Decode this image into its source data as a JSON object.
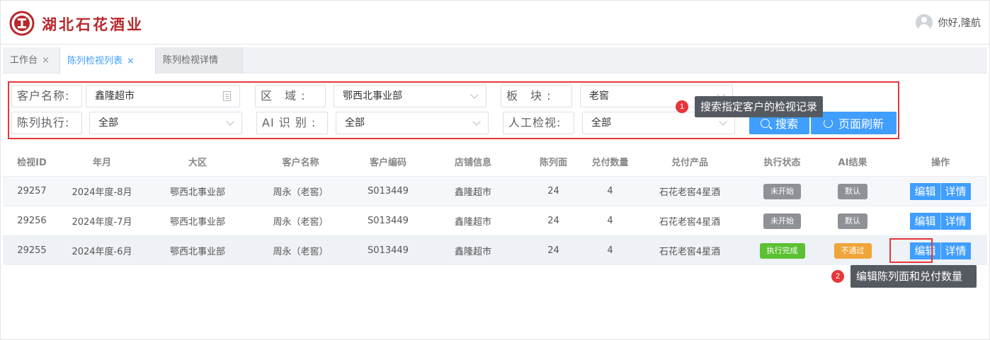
{
  "header": {
    "brand": "湖北石花酒业",
    "greeting": "你好,隆航",
    "colors": {
      "brand": "#b8282c",
      "accent": "#409eff",
      "alert": "#e8363a"
    }
  },
  "tabs": [
    {
      "label": "工作台",
      "close": "×"
    },
    {
      "label": "陈列检视列表",
      "close": "×"
    },
    {
      "label": "陈列检视详情",
      "close": ""
    }
  ],
  "filters": {
    "customer_label": "客户名称:",
    "customer_value": "鑫隆超市",
    "region_label": "区　域 :",
    "region_value": "鄂西北事业部",
    "block_label": "板　块 :",
    "block_value": "老窖",
    "exec_label": "陈列执行:",
    "exec_value": "全部",
    "ai_label": "AI 识 别 :",
    "ai_value": "全部",
    "manual_label": "人工检视:",
    "manual_value": "全部",
    "search_btn": "搜索",
    "refresh_btn": "页面刷新"
  },
  "annotations": [
    {
      "num": "1",
      "text": "搜索指定客户的检视记录"
    },
    {
      "num": "2",
      "text": "编辑陈列面和兑付数量"
    }
  ],
  "table": {
    "headers": [
      "检视ID",
      "年月",
      "大区",
      "客户名称",
      "客户编码",
      "店铺信息",
      "陈列面",
      "兑付数量",
      "兑付产品",
      "执行状态",
      "AI结果",
      "操作"
    ],
    "rows": [
      [
        "29257",
        "2024年度-8月",
        "鄂西北事业部",
        "周永（老窖）",
        "S013449",
        "鑫隆超市",
        "24",
        "4",
        "石花老窖4星酒",
        "未开始",
        "默认",
        "编辑",
        "详情"
      ],
      [
        "29256",
        "2024年度-7月",
        "鄂西北事业部",
        "周永（老窖）",
        "S013449",
        "鑫隆超市",
        "24",
        "4",
        "石花老窖4星酒",
        "未开始",
        "默认",
        "编辑",
        "详情"
      ],
      [
        "29255",
        "2024年度-6月",
        "鄂西北事业部",
        "周永（老窖）",
        "S013449",
        "鑫隆超市",
        "24",
        "4",
        "石花老窖4星酒",
        "执行完成",
        "不通过",
        "编辑",
        "详情"
      ]
    ],
    "status_colors": {
      "未开始": "gray",
      "执行完成": "green",
      "默认": "gray",
      "不通过": "orange"
    }
  }
}
